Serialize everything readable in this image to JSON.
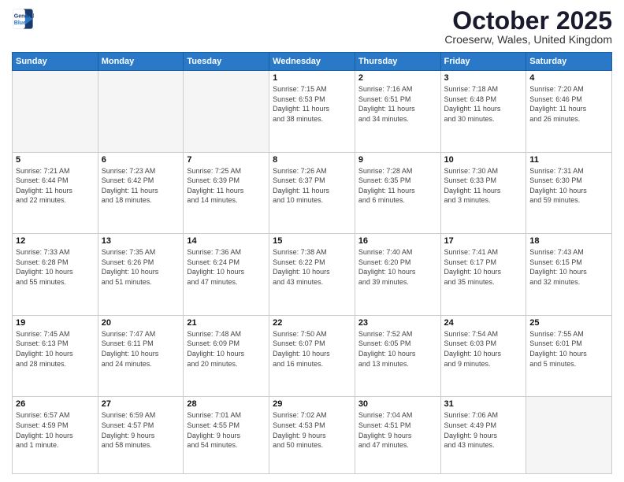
{
  "header": {
    "logo_line1": "General",
    "logo_line2": "Blue",
    "month": "October 2025",
    "location": "Croeserw, Wales, United Kingdom"
  },
  "days_of_week": [
    "Sunday",
    "Monday",
    "Tuesday",
    "Wednesday",
    "Thursday",
    "Friday",
    "Saturday"
  ],
  "weeks": [
    [
      {
        "day": "",
        "info": ""
      },
      {
        "day": "",
        "info": ""
      },
      {
        "day": "",
        "info": ""
      },
      {
        "day": "1",
        "info": "Sunrise: 7:15 AM\nSunset: 6:53 PM\nDaylight: 11 hours\nand 38 minutes."
      },
      {
        "day": "2",
        "info": "Sunrise: 7:16 AM\nSunset: 6:51 PM\nDaylight: 11 hours\nand 34 minutes."
      },
      {
        "day": "3",
        "info": "Sunrise: 7:18 AM\nSunset: 6:48 PM\nDaylight: 11 hours\nand 30 minutes."
      },
      {
        "day": "4",
        "info": "Sunrise: 7:20 AM\nSunset: 6:46 PM\nDaylight: 11 hours\nand 26 minutes."
      }
    ],
    [
      {
        "day": "5",
        "info": "Sunrise: 7:21 AM\nSunset: 6:44 PM\nDaylight: 11 hours\nand 22 minutes."
      },
      {
        "day": "6",
        "info": "Sunrise: 7:23 AM\nSunset: 6:42 PM\nDaylight: 11 hours\nand 18 minutes."
      },
      {
        "day": "7",
        "info": "Sunrise: 7:25 AM\nSunset: 6:39 PM\nDaylight: 11 hours\nand 14 minutes."
      },
      {
        "day": "8",
        "info": "Sunrise: 7:26 AM\nSunset: 6:37 PM\nDaylight: 11 hours\nand 10 minutes."
      },
      {
        "day": "9",
        "info": "Sunrise: 7:28 AM\nSunset: 6:35 PM\nDaylight: 11 hours\nand 6 minutes."
      },
      {
        "day": "10",
        "info": "Sunrise: 7:30 AM\nSunset: 6:33 PM\nDaylight: 11 hours\nand 3 minutes."
      },
      {
        "day": "11",
        "info": "Sunrise: 7:31 AM\nSunset: 6:30 PM\nDaylight: 10 hours\nand 59 minutes."
      }
    ],
    [
      {
        "day": "12",
        "info": "Sunrise: 7:33 AM\nSunset: 6:28 PM\nDaylight: 10 hours\nand 55 minutes."
      },
      {
        "day": "13",
        "info": "Sunrise: 7:35 AM\nSunset: 6:26 PM\nDaylight: 10 hours\nand 51 minutes."
      },
      {
        "day": "14",
        "info": "Sunrise: 7:36 AM\nSunset: 6:24 PM\nDaylight: 10 hours\nand 47 minutes."
      },
      {
        "day": "15",
        "info": "Sunrise: 7:38 AM\nSunset: 6:22 PM\nDaylight: 10 hours\nand 43 minutes."
      },
      {
        "day": "16",
        "info": "Sunrise: 7:40 AM\nSunset: 6:20 PM\nDaylight: 10 hours\nand 39 minutes."
      },
      {
        "day": "17",
        "info": "Sunrise: 7:41 AM\nSunset: 6:17 PM\nDaylight: 10 hours\nand 35 minutes."
      },
      {
        "day": "18",
        "info": "Sunrise: 7:43 AM\nSunset: 6:15 PM\nDaylight: 10 hours\nand 32 minutes."
      }
    ],
    [
      {
        "day": "19",
        "info": "Sunrise: 7:45 AM\nSunset: 6:13 PM\nDaylight: 10 hours\nand 28 minutes."
      },
      {
        "day": "20",
        "info": "Sunrise: 7:47 AM\nSunset: 6:11 PM\nDaylight: 10 hours\nand 24 minutes."
      },
      {
        "day": "21",
        "info": "Sunrise: 7:48 AM\nSunset: 6:09 PM\nDaylight: 10 hours\nand 20 minutes."
      },
      {
        "day": "22",
        "info": "Sunrise: 7:50 AM\nSunset: 6:07 PM\nDaylight: 10 hours\nand 16 minutes."
      },
      {
        "day": "23",
        "info": "Sunrise: 7:52 AM\nSunset: 6:05 PM\nDaylight: 10 hours\nand 13 minutes."
      },
      {
        "day": "24",
        "info": "Sunrise: 7:54 AM\nSunset: 6:03 PM\nDaylight: 10 hours\nand 9 minutes."
      },
      {
        "day": "25",
        "info": "Sunrise: 7:55 AM\nSunset: 6:01 PM\nDaylight: 10 hours\nand 5 minutes."
      }
    ],
    [
      {
        "day": "26",
        "info": "Sunrise: 6:57 AM\nSunset: 4:59 PM\nDaylight: 10 hours\nand 1 minute."
      },
      {
        "day": "27",
        "info": "Sunrise: 6:59 AM\nSunset: 4:57 PM\nDaylight: 9 hours\nand 58 minutes."
      },
      {
        "day": "28",
        "info": "Sunrise: 7:01 AM\nSunset: 4:55 PM\nDaylight: 9 hours\nand 54 minutes."
      },
      {
        "day": "29",
        "info": "Sunrise: 7:02 AM\nSunset: 4:53 PM\nDaylight: 9 hours\nand 50 minutes."
      },
      {
        "day": "30",
        "info": "Sunrise: 7:04 AM\nSunset: 4:51 PM\nDaylight: 9 hours\nand 47 minutes."
      },
      {
        "day": "31",
        "info": "Sunrise: 7:06 AM\nSunset: 4:49 PM\nDaylight: 9 hours\nand 43 minutes."
      },
      {
        "day": "",
        "info": ""
      }
    ]
  ]
}
